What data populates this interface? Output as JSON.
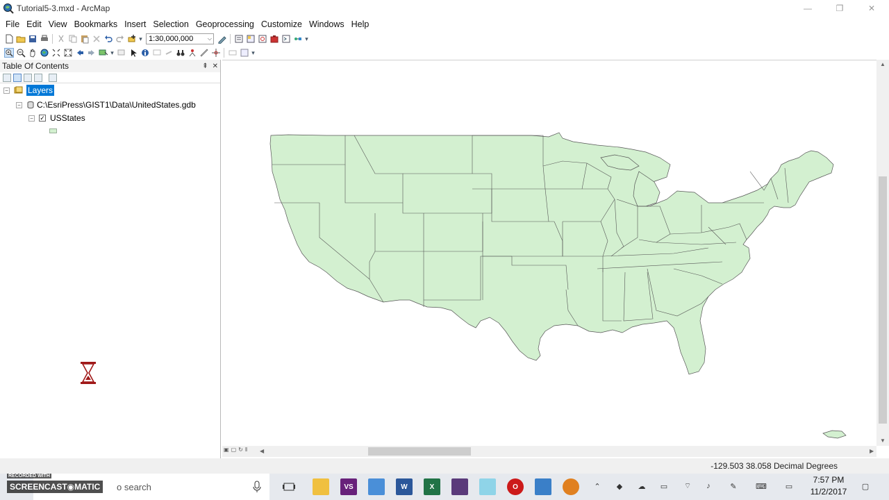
{
  "window": {
    "title": "Tutorial5-3.mxd - ArcMap",
    "minimize": "—",
    "maximize": "❐",
    "close": "✕"
  },
  "menu": [
    "File",
    "Edit",
    "View",
    "Bookmarks",
    "Insert",
    "Selection",
    "Geoprocessing",
    "Customize",
    "Windows",
    "Help"
  ],
  "toolbar": {
    "scale_value": "1:30,000,000"
  },
  "toc": {
    "title": "Table Of Contents",
    "pin": "⇞",
    "close": "✕",
    "layers_label": "Layers",
    "gdb_path": "C:\\EsriPress\\GIST1\\Data\\UnitedStates.gdb",
    "layer_name": "USStates",
    "expander_collapse": "−",
    "checked": "✓"
  },
  "map": {
    "fill_color": "#d3f0d0",
    "stroke_color": "#555555"
  },
  "status": {
    "coordinates": "-129.503  38.058 Decimal Degrees"
  },
  "taskbar": {
    "recorded_with": "RECORDED WITH",
    "screencast": "SCREENCAST◉MATIC",
    "search_placeholder": "o search",
    "time": "7:57 PM",
    "date": "11/2/2017"
  }
}
